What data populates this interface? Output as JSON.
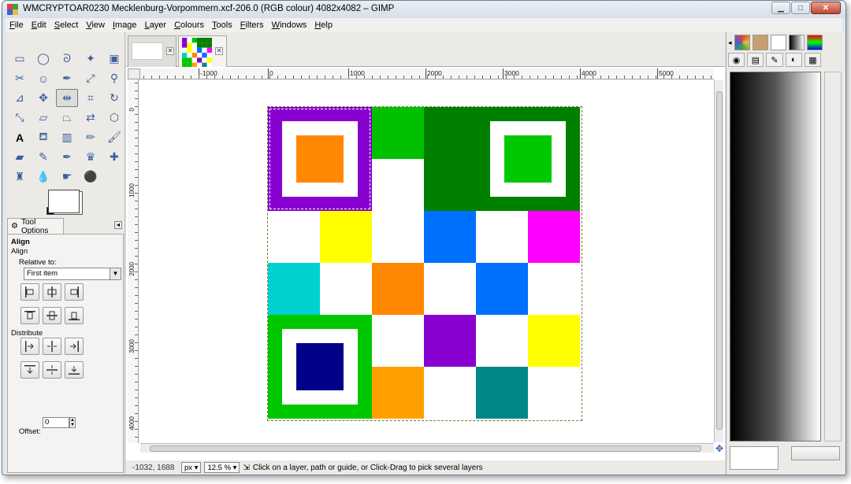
{
  "window": {
    "title": "WMCRYPTOAR0230 Mecklenburg-Vorpommern.xcf-206.0 (RGB colour) 4082x4082 – GIMP"
  },
  "menu": [
    {
      "label": "File",
      "u": "F",
      "rest": "ile"
    },
    {
      "label": "Edit",
      "u": "E",
      "rest": "dit"
    },
    {
      "label": "Select",
      "u": "S",
      "rest": "elect"
    },
    {
      "label": "View",
      "u": "V",
      "rest": "iew"
    },
    {
      "label": "Image",
      "u": "I",
      "rest": "mage"
    },
    {
      "label": "Layer",
      "u": "L",
      "rest": "ayer"
    },
    {
      "label": "Colours",
      "u": "C",
      "rest": "olours"
    },
    {
      "label": "Tools",
      "u": "T",
      "rest": "ools"
    },
    {
      "label": "Filters",
      "u": "F",
      "rest": "ilters"
    },
    {
      "label": "Windows",
      "u": "W",
      "rest": "indows"
    },
    {
      "label": "Help",
      "u": "H",
      "rest": "elp"
    }
  ],
  "toolbox": {
    "tools": [
      "rect-select-icon",
      "ellipse-select-icon",
      "free-select-icon",
      "fuzzy-select-icon",
      "select-by-color-icon",
      "scissors-select-icon",
      "foreground-select-icon",
      "paths-icon",
      "color-picker-icon",
      "zoom-icon",
      "measure-icon",
      "move-icon",
      "align-icon",
      "crop-icon",
      "rotate-icon",
      "scale-icon",
      "shear-icon",
      "perspective-icon",
      "flip-icon",
      "cage-transform-icon",
      "text-icon",
      "bucket-fill-icon",
      "blend-icon",
      "pencil-icon",
      "paintbrush-icon",
      "eraser-icon",
      "airbrush-icon",
      "ink-icon",
      "clone-icon",
      "heal-icon",
      "perspective-clone-icon",
      "blur-icon",
      "smudge-icon",
      "dodge-burn-icon"
    ],
    "active_tool": "align-icon"
  },
  "tool_options": {
    "tab_label": "Tool Options",
    "heading": "Align",
    "subheading": "Align",
    "relative_label": "Relative to:",
    "relative_value": "First item",
    "distribute_label": "Distribute",
    "offset_label": "Offset:",
    "offset_value": "0"
  },
  "canvas": {
    "ruler_h": [
      "-1000",
      "0",
      "1000",
      "2000",
      "3000",
      "4000",
      "5000"
    ],
    "ruler_v": [
      "0",
      "1000",
      "2000",
      "3000",
      "4000"
    ],
    "grid": [
      [
        "#8800d0",
        "#ffffff",
        "#00c000",
        "#008000",
        "#008000",
        "#008000"
      ],
      [
        "#8800d0",
        "#ffff00",
        "#ffffff",
        "#008000",
        "#008000",
        "#008000"
      ],
      [
        "#ffffff",
        "#ffff00",
        "#ffffff",
        "#0070ff",
        "#ffffff",
        "#ff00ff"
      ],
      [
        "#00d0d0",
        "#ffffff",
        "#ff8800",
        "#ffffff",
        "#0070ff",
        "#ffffff"
      ],
      [
        "#00c800",
        "#00c800",
        "#ffffff",
        "#8800d0",
        "#ffffff",
        "#ffff00"
      ],
      [
        "#00c800",
        "#00c800",
        "#ffa000",
        "#ffffff",
        "#008888",
        "#ffffff"
      ]
    ],
    "finder_patterns": [
      {
        "outer": "#8800d0",
        "inner": "#ff8800"
      },
      {
        "outer": "#008000",
        "inner": "#00c800"
      },
      {
        "outer": "#00c800",
        "inner": "#000088"
      }
    ]
  },
  "statusbar": {
    "coords": "-1032, 1688",
    "unit": "px",
    "zoom": "12.5 %",
    "message": "Click on a layer, path or guide, or Click-Drag to pick several layers"
  },
  "colors": {
    "accent": "#2a5aa8",
    "window_bg": "#dfe6ee",
    "panel_bg": "#eceae6"
  }
}
